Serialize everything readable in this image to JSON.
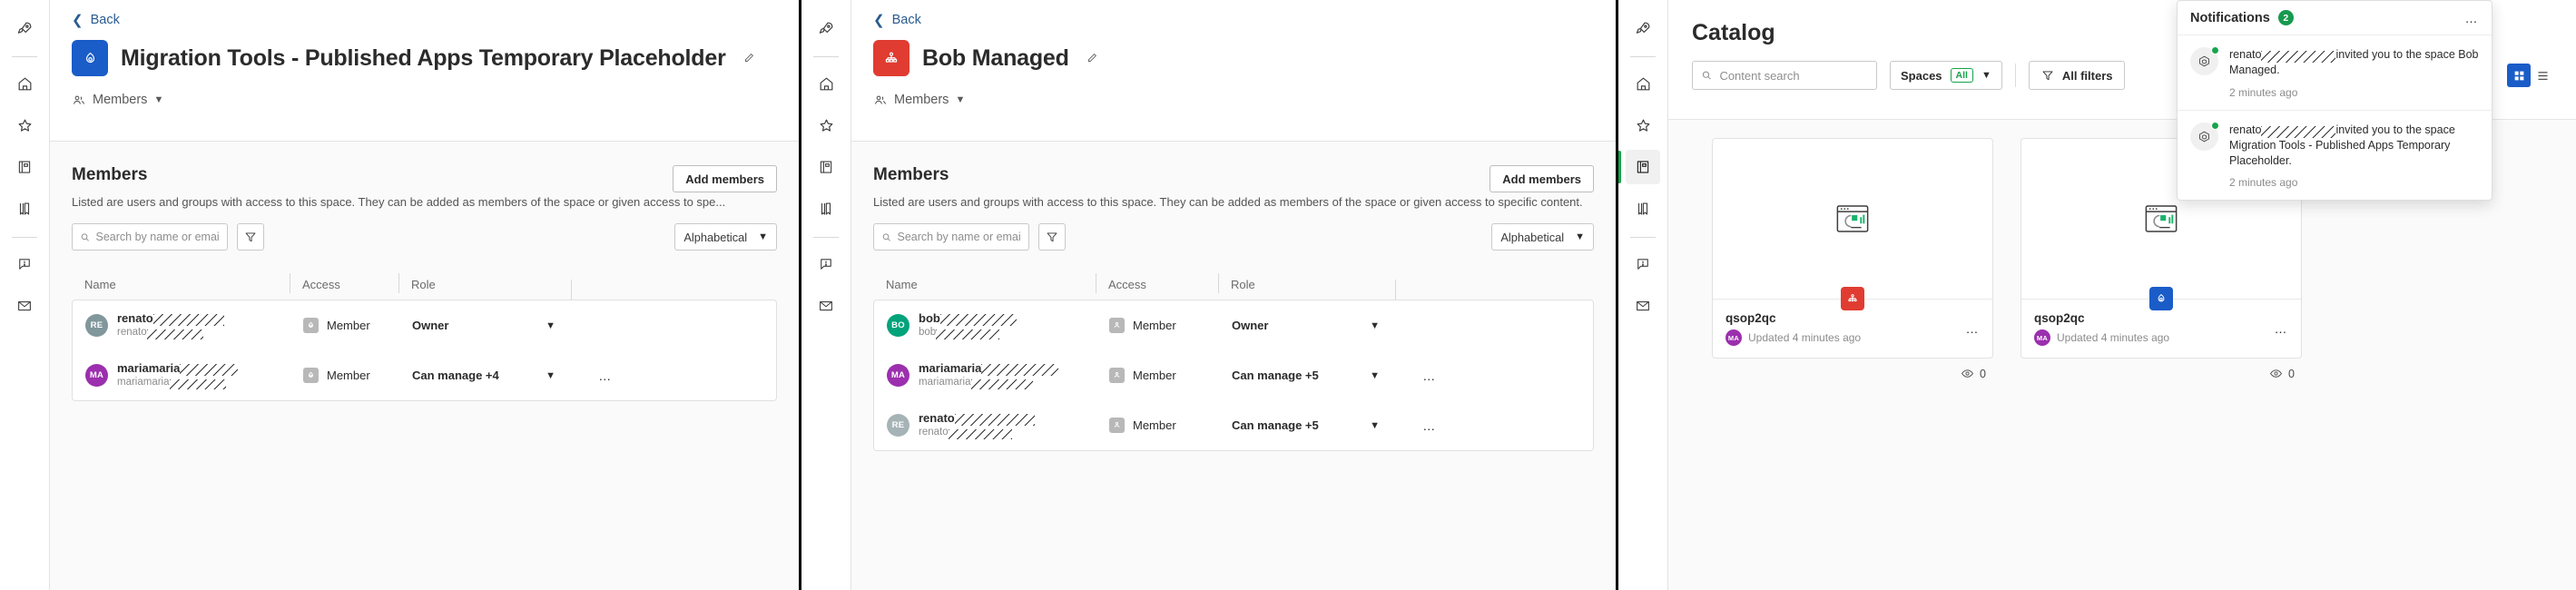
{
  "rail": {
    "items": [
      {
        "name": "rocket-icon",
        "label": "Explore"
      },
      {
        "name": "home-icon",
        "label": "Home"
      },
      {
        "name": "star-icon",
        "label": "Favorites"
      },
      {
        "name": "catalog-icon",
        "label": "Catalog"
      },
      {
        "name": "bookmark-icon",
        "label": "Collections"
      },
      {
        "name": "alerts-icon",
        "label": "Alerts"
      },
      {
        "name": "mail-icon",
        "label": "Subscriptions"
      }
    ]
  },
  "panel1": {
    "back_label": "Back",
    "title": "Migration Tools - Published Apps Temporary Placeholder",
    "tab_label": "Members",
    "members": {
      "heading": "Members",
      "description": "Listed are users and groups with access to this space. They can be added as members of the space or given access to spe...",
      "add_button": "Add members",
      "search_placeholder": "Search by name or email",
      "sort_label": "Alphabetical",
      "columns": [
        "Name",
        "Access",
        "Role",
        ""
      ],
      "rows": [
        {
          "initials": "RE",
          "avatar_color": "#80979b",
          "name": "renato",
          "name_redact_w": 78,
          "email": "renato",
          "email_redact_w": 62,
          "access": "Member",
          "role": "Owner",
          "has_menu": false
        },
        {
          "initials": "MA",
          "avatar_color": "#9b2fae",
          "name": "mariamaria",
          "name_redact_w": 64,
          "email": "mariamaria",
          "email_redact_w": 62,
          "access": "Member",
          "role": "Can manage +4",
          "has_menu": true
        }
      ]
    }
  },
  "panel2": {
    "back_label": "Back",
    "title": "Bob Managed",
    "tab_label": "Members",
    "members": {
      "heading": "Members",
      "description": "Listed are users and groups with access to this space. They can be added as members of the space or given access to specific content.",
      "add_button": "Add members",
      "search_placeholder": "Search by name or email",
      "sort_label": "Alphabetical",
      "columns": [
        "Name",
        "Access",
        "Role",
        ""
      ],
      "rows": [
        {
          "initials": "BO",
          "avatar_color": "#00a37a",
          "name": "bob",
          "name_redact_w": 84,
          "email": "bob",
          "email_redact_w": 70,
          "access": "Member",
          "role": "Owner",
          "has_menu": false
        },
        {
          "initials": "MA",
          "avatar_color": "#9b2fae",
          "name": "mariamaria",
          "name_redact_w": 85,
          "email": "mariamaria",
          "email_redact_w": 68,
          "access": "Member",
          "role": "Can manage +5",
          "has_menu": true
        },
        {
          "initials": "RE",
          "avatar_color": "#a6b3b6",
          "name": "renato",
          "name_redact_w": 88,
          "email": "renato",
          "email_redact_w": 70,
          "access": "Member",
          "role": "Can manage +5",
          "has_menu": true
        }
      ]
    }
  },
  "panel3": {
    "catalog": {
      "title": "Catalog",
      "search_placeholder": "Content search",
      "spaces_label": "Spaces",
      "spaces_value": "All",
      "filters_label": "All filters",
      "cards": [
        {
          "name": "qsop2qc",
          "meta": "Updated 4 minutes ago",
          "owner_initials": "MA",
          "owner_color": "#9b2fae",
          "badge_color": "#e03c31",
          "badge_icon": "managed-space-icon",
          "views": "0"
        },
        {
          "name": "qsop2qc",
          "meta": "Updated 4 minutes ago",
          "owner_initials": "MA",
          "owner_color": "#9b2fae",
          "badge_color": "#1a5cc8",
          "badge_icon": "shared-space-icon",
          "views": "0"
        }
      ]
    },
    "notifications": {
      "title": "Notifications",
      "count": "2",
      "items": [
        {
          "actor": "renato",
          "actor_redact_w": 82,
          "text": "invited you to the space Bob Managed.",
          "time": "2 minutes ago"
        },
        {
          "actor": "renato",
          "actor_redact_w": 82,
          "text": "invited you to the space Migration Tools - Published Apps Temporary Placeholder.",
          "time": "2 minutes ago"
        }
      ]
    }
  }
}
